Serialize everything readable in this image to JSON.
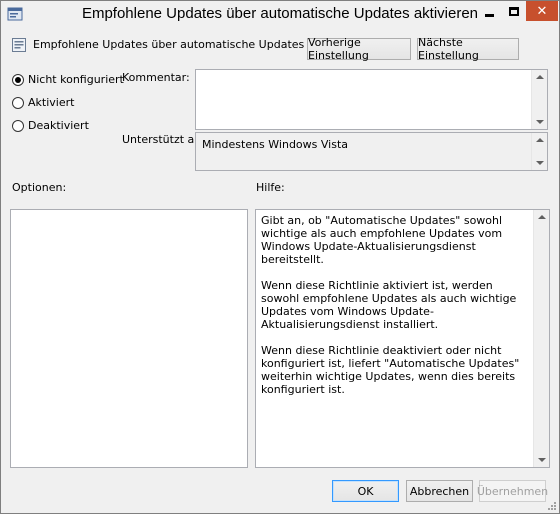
{
  "window": {
    "title": "Empfohlene Updates über automatische Updates aktivieren",
    "close_glyph": "✕"
  },
  "header": {
    "policy_name": "Empfohlene Updates über automatische Updates aktivieren",
    "prev_button": "Vorherige Einstellung",
    "next_button": "Nächste Einstellung"
  },
  "state": {
    "options": [
      {
        "label": "Nicht konfiguriert",
        "checked": true
      },
      {
        "label": "Aktiviert",
        "checked": false
      },
      {
        "label": "Deaktiviert",
        "checked": false
      }
    ]
  },
  "comment": {
    "label": "Kommentar:",
    "value": ""
  },
  "supported": {
    "label": "Unterstützt auf:",
    "value": "Mindestens Windows Vista"
  },
  "options_pane": {
    "label": "Optionen:"
  },
  "help_pane": {
    "label": "Hilfe:",
    "paragraphs": [
      "Gibt an, ob \"Automatische Updates\" sowohl wichtige als auch empfohlene Updates vom Windows Update-Aktualisierungsdienst bereitstellt.",
      "Wenn diese Richtlinie aktiviert ist, werden sowohl empfohlene Updates als auch wichtige Updates vom Windows Update-Aktualisierungsdienst installiert.",
      "Wenn diese Richtlinie deaktiviert oder nicht konfiguriert ist, liefert \"Automatische Updates\" weiterhin wichtige Updates, wenn dies bereits konfiguriert ist."
    ]
  },
  "footer": {
    "ok": "OK",
    "cancel": "Abbrechen",
    "apply": "Übernehmen"
  },
  "colors": {
    "window_bg": "#f0f0f0",
    "close_button": "#c7502d",
    "default_button_border": "#3399ff"
  }
}
